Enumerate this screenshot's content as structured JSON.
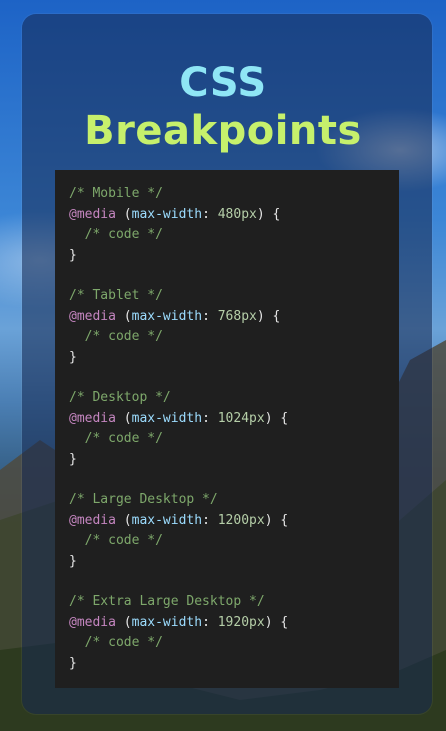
{
  "title": {
    "line1": "CSS",
    "line2": "Breakpoints"
  },
  "code": {
    "blocks": [
      {
        "comment": "/* Mobile */",
        "keyword": "@media",
        "open": " (",
        "property": "max-width",
        "sep": ": ",
        "value": "480px",
        "close": ") {",
        "inner": "  /* code */",
        "end": "}"
      },
      {
        "comment": "/* Tablet */",
        "keyword": "@media",
        "open": " (",
        "property": "max-width",
        "sep": ": ",
        "value": "768px",
        "close": ") {",
        "inner": "  /* code */",
        "end": "}"
      },
      {
        "comment": "/* Desktop */",
        "keyword": "@media",
        "open": " (",
        "property": "max-width",
        "sep": ": ",
        "value": "1024px",
        "close": ") {",
        "inner": "  /* code */",
        "end": "}"
      },
      {
        "comment": "/* Large Desktop */",
        "keyword": "@media",
        "open": " (",
        "property": "max-width",
        "sep": ": ",
        "value": "1200px",
        "close": ") {",
        "inner": "  /* code */",
        "end": "}"
      },
      {
        "comment": "/* Extra Large Desktop */",
        "keyword": "@media",
        "open": " (",
        "property": "max-width",
        "sep": ": ",
        "value": "1920px",
        "close": ") {",
        "inner": "  /* code */",
        "end": "}"
      }
    ]
  },
  "colors": {
    "title_line1": "#8fe6f5",
    "title_line2": "#c6f06c",
    "code_bg": "#1f1f1f",
    "comment": "#7ea86b",
    "keyword": "#c586c0",
    "property": "#9cdcfe",
    "number": "#b5cea8"
  }
}
